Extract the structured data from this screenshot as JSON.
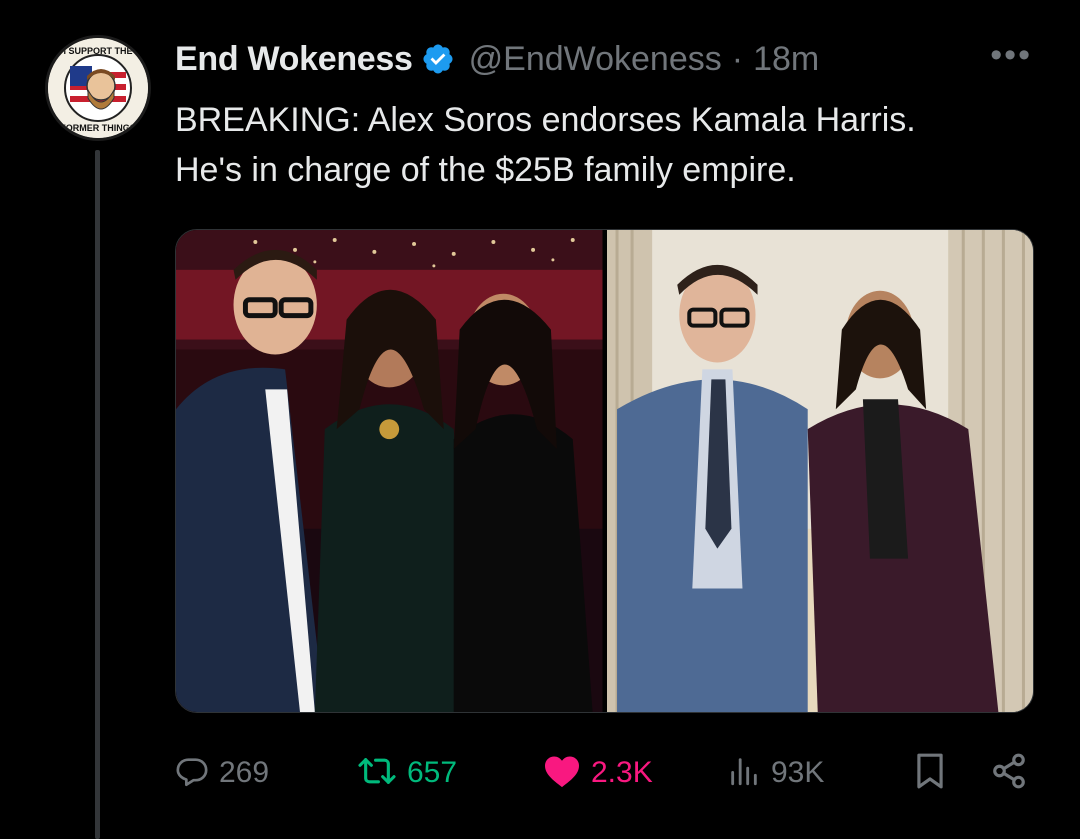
{
  "tweet": {
    "display_name": "End Wokeness",
    "handle": "@EndWokeness",
    "separator": "·",
    "time": "18m",
    "more_label": "•••",
    "text_lines": [
      "BREAKING: Alex Soros endorses Kamala Harris.",
      "He's in charge of the $25B family empire."
    ]
  },
  "avatar": {
    "badge_top": "I SUPPORT THE",
    "badge_bottom": "FORMER THINGS"
  },
  "media": {
    "photos": [
      "party-photo",
      "office-photo"
    ]
  },
  "actions": {
    "reply_count": "269",
    "retweet_count": "657",
    "like_count": "2.3K",
    "views_count": "93K"
  },
  "icons": {
    "reply": "reply-icon",
    "retweet": "retweet-icon",
    "like": "heart-icon",
    "views": "views-icon",
    "bookmark": "bookmark-icon",
    "share": "share-icon",
    "verified": "verified-badge-icon"
  },
  "colors": {
    "background": "#000000",
    "text": "#e7e9ea",
    "muted": "#71767b",
    "verified": "#1d9bf0",
    "retweet": "#00ba7c",
    "like": "#f91880"
  }
}
